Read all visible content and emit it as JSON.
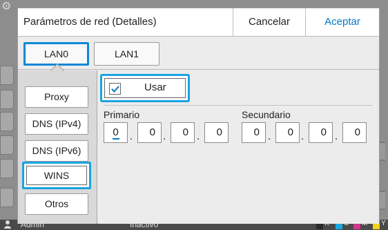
{
  "dialog": {
    "title": "Parámetros de red (Detalles)",
    "cancel_label": "Cancelar",
    "ok_label": "Aceptar"
  },
  "tabs": [
    {
      "label": "LAN0",
      "active": true
    },
    {
      "label": "LAN1",
      "active": false
    }
  ],
  "side_menu": [
    {
      "label": "Proxy",
      "active": false
    },
    {
      "label": "DNS (IPv4)",
      "active": false
    },
    {
      "label": "DNS (IPv6)",
      "active": false
    },
    {
      "label": "WINS",
      "active": true
    },
    {
      "label": "Otros",
      "active": false
    }
  ],
  "use_toggle": {
    "label": "Usar",
    "checked": true
  },
  "primary": {
    "label": "Primario",
    "octets": [
      "0",
      "0",
      "0",
      "0"
    ]
  },
  "secondary": {
    "label": "Secundario",
    "octets": [
      "0",
      "0",
      "0",
      "0"
    ]
  },
  "status_bar": {
    "user": "Admin",
    "status": "Inactivo",
    "inks": [
      "K",
      "C",
      "M",
      "Y"
    ]
  },
  "colors": {
    "accent": "#0077c8",
    "highlight": "#18a4e2",
    "ink_k": "#2b2b2b",
    "ink_c": "#1aa7e0",
    "ink_m": "#d6338a",
    "ink_y": "#f2d21a"
  }
}
